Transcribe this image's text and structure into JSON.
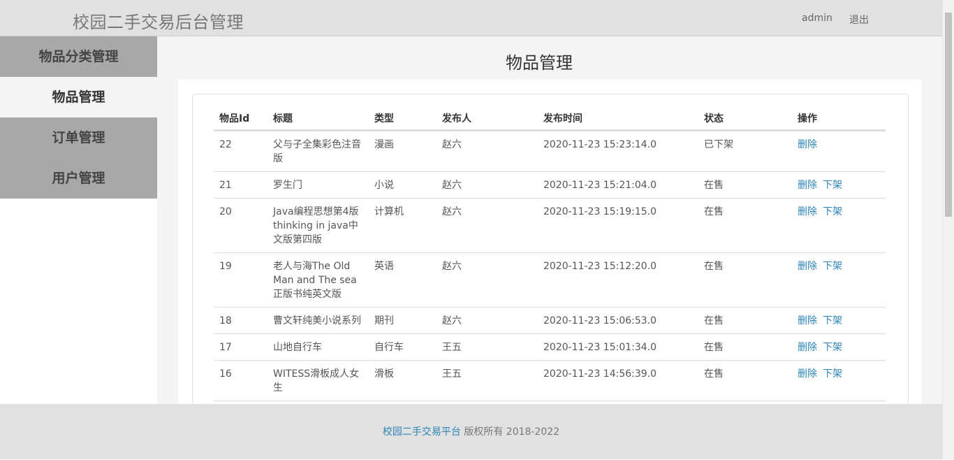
{
  "header": {
    "brand": "校园二手交易后台管理",
    "user": "admin",
    "logout": "退出"
  },
  "sidebar": {
    "items": [
      {
        "label": "物品分类管理"
      },
      {
        "label": "物品管理"
      },
      {
        "label": "订单管理"
      },
      {
        "label": "用户管理"
      }
    ]
  },
  "main": {
    "title": "物品管理"
  },
  "table": {
    "headers": {
      "id": "物品Id",
      "title": "标题",
      "type": "类型",
      "publisher": "发布人",
      "time": "发布时间",
      "status": "状态",
      "actions": "操作"
    },
    "rows": [
      {
        "id": "22",
        "title": "父与子全集彩色注音版",
        "type": "漫画",
        "publisher": "赵六",
        "time": "2020-11-23 15:23:14.0",
        "status": "已下架",
        "delete": "删除",
        "takedown": ""
      },
      {
        "id": "21",
        "title": "罗生门",
        "type": "小说",
        "publisher": "赵六",
        "time": "2020-11-23 15:21:04.0",
        "status": "在售",
        "delete": "删除",
        "takedown": "下架"
      },
      {
        "id": "20",
        "title": "Java编程思想第4版 thinking in java中文版第四版",
        "type": "计算机",
        "publisher": "赵六",
        "time": "2020-11-23 15:19:15.0",
        "status": "在售",
        "delete": "删除",
        "takedown": "下架"
      },
      {
        "id": "19",
        "title": "老人与海The Old Man and The sea正版书纯英文版",
        "type": "英语",
        "publisher": "赵六",
        "time": "2020-11-23 15:12:20.0",
        "status": "在售",
        "delete": "删除",
        "takedown": "下架"
      },
      {
        "id": "18",
        "title": "曹文轩纯美小说系列",
        "type": "期刊",
        "publisher": "赵六",
        "time": "2020-11-23 15:06:53.0",
        "status": "在售",
        "delete": "删除",
        "takedown": "下架"
      },
      {
        "id": "17",
        "title": "山地自行车",
        "type": "自行车",
        "publisher": "王五",
        "time": "2020-11-23 15:01:34.0",
        "status": "在售",
        "delete": "删除",
        "takedown": "下架"
      },
      {
        "id": "16",
        "title": "WITESS滑板成人女生",
        "type": "滑板",
        "publisher": "王五",
        "time": "2020-11-23 14:56:39.0",
        "status": "在售",
        "delete": "删除",
        "takedown": "下架"
      }
    ]
  },
  "footer": {
    "link": "校园二手交易平台",
    "text": "版权所有  2018-2022"
  }
}
